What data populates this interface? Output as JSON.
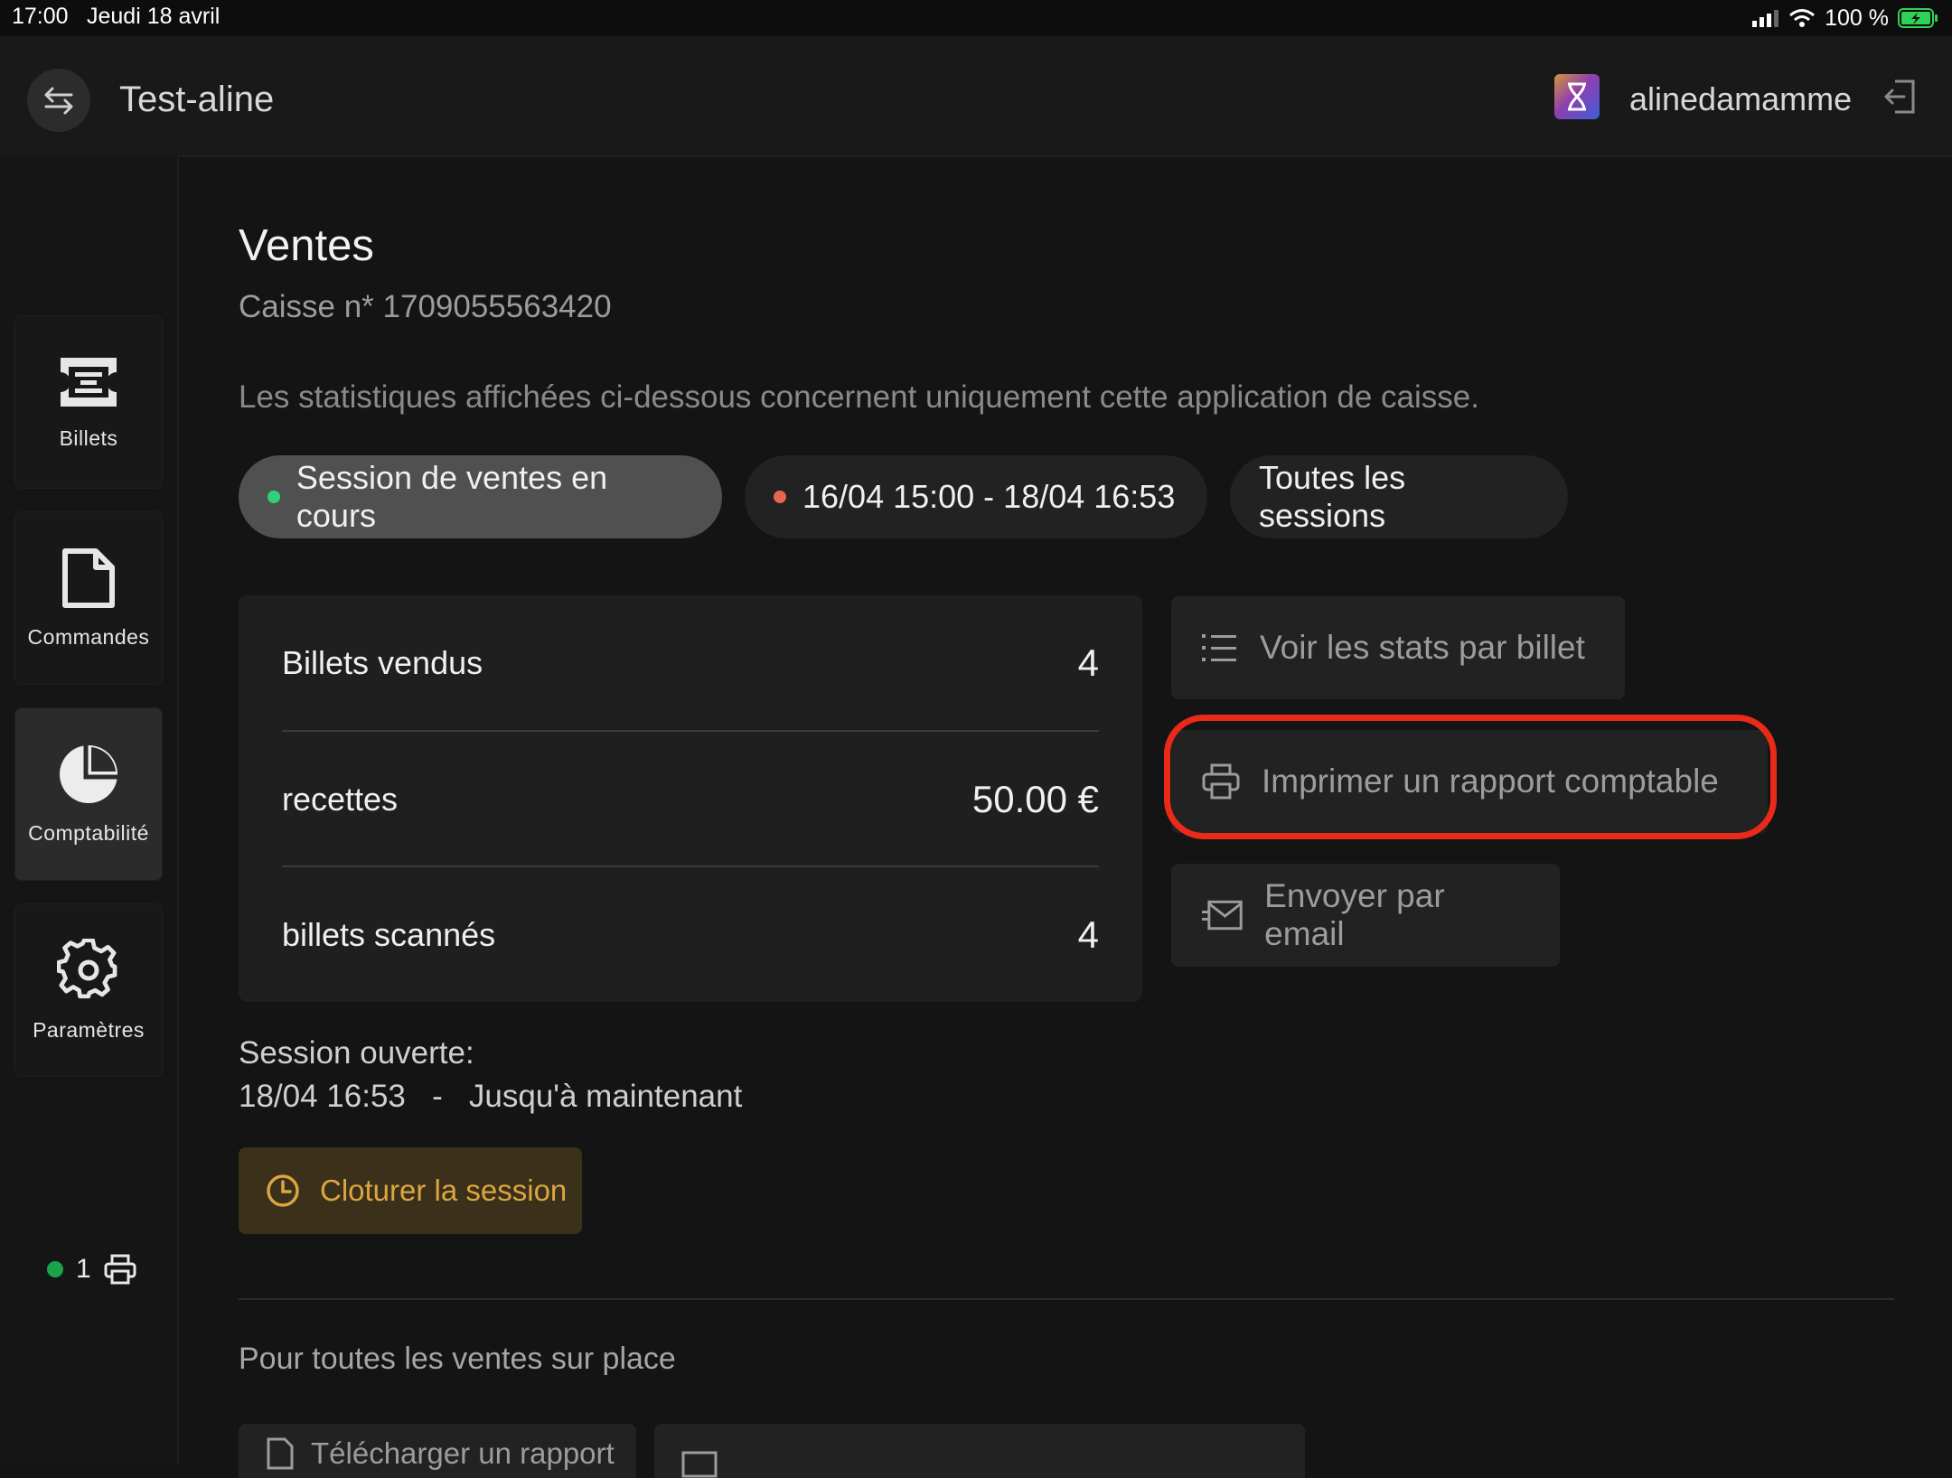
{
  "status_bar": {
    "time": "17:00",
    "date": "Jeudi 18 avril",
    "battery": "100 %"
  },
  "header": {
    "project": "Test-aline",
    "username": "alinedamamme"
  },
  "sidebar": {
    "items": [
      {
        "label": "Billets",
        "icon": "ticket-icon"
      },
      {
        "label": "Commandes",
        "icon": "document-icon"
      },
      {
        "label": "Comptabilité",
        "icon": "pie-chart-icon",
        "active": true
      },
      {
        "label": "Paramètres",
        "icon": "gear-icon"
      }
    ],
    "printer_count": "1"
  },
  "main": {
    "title": "Ventes",
    "subtitle": "Caisse n* 1709055563420",
    "info": "Les statistiques affichées ci-dessous concernent uniquement cette application de caisse.",
    "session_chips": [
      {
        "label": "Session de ventes en cours",
        "dot_color": "#2fd27a",
        "active": true
      },
      {
        "label": "16/04 15:00 - 18/04 16:53",
        "dot_color": "#e8664f"
      },
      {
        "label": "Toutes les sessions"
      }
    ],
    "stats": [
      {
        "label": "Billets vendus",
        "value": "4"
      },
      {
        "label": "recettes",
        "value": "50.00 €"
      },
      {
        "label": "billets scannés",
        "value": "4"
      }
    ],
    "actions": {
      "stats_per_ticket": "Voir les stats par billet",
      "print_report": "Imprimer un rapport comptable",
      "send_email": "Envoyer par email"
    },
    "session": {
      "label": "Session ouverte:",
      "range": "18/04 16:53   -   Jusqu'à maintenant",
      "close_button": "Cloturer la session"
    },
    "onsite_section": {
      "title": "Pour toutes les ventes sur place",
      "download_button": "Télécharger un rapport"
    }
  },
  "colors": {
    "highlight": "#ea2a19",
    "close_text": "#dba63f",
    "close_bg": "#3b301a",
    "printer_dot": "#1aa34a"
  }
}
